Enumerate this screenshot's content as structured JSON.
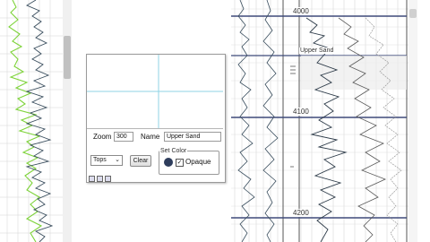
{
  "dialog": {
    "zoom_label": "Zoom",
    "zoom_value": "300",
    "name_label": "Name",
    "name_value": "Upper Sand",
    "type_select": "Tops",
    "clear_label": "Clear",
    "color_group_label": "Set Color",
    "opaque_label": "Opaque",
    "opaque_checked": true
  },
  "log": {
    "depths": [
      "4000",
      "4100",
      "4200"
    ],
    "top_label": "Upper Sand",
    "colors": {
      "curve_dark": "#3a4e5e",
      "curve_green": "#7ed33a",
      "depth_line": "#3f4a7a",
      "grid": "#c8c8c8"
    }
  }
}
